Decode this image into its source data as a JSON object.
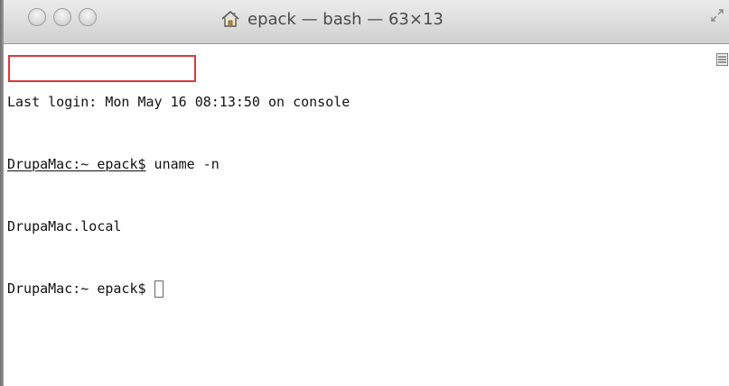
{
  "window": {
    "title": "epack — bash — 63×13",
    "title_icon": "home-icon",
    "traffic_lights": [
      "close",
      "minimize",
      "zoom"
    ]
  },
  "terminal": {
    "lines": [
      {
        "prompt_host": "",
        "text": "Last login: Mon May 16 08:13:50 on console"
      },
      {
        "prompt_host": "DrupaMac:~ epack$",
        "text": " uname -n"
      },
      {
        "prompt_host": "",
        "text": "DrupaMac.local"
      },
      {
        "prompt_host": "DrupaMac:~ epack$",
        "text": ""
      }
    ],
    "highlighted_output": "DrupaMac.local"
  },
  "colors": {
    "highlight": "#d63a3a",
    "text": "#111111",
    "title": "#4a4a4a"
  }
}
